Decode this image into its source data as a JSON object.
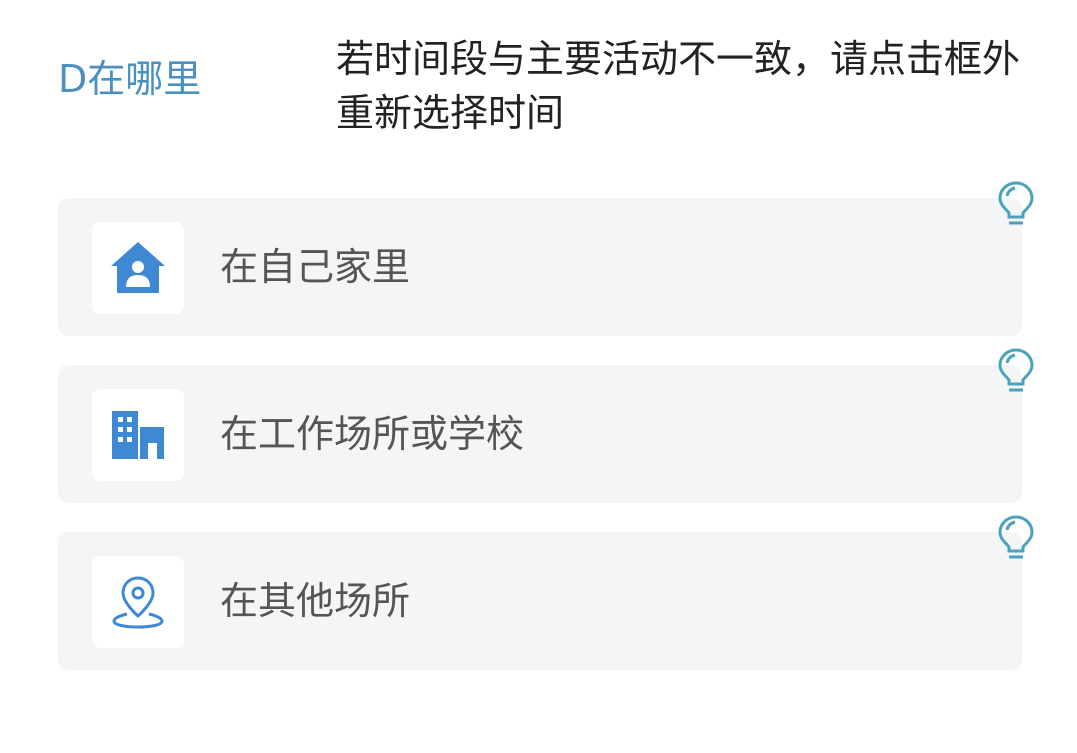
{
  "question": {
    "title": "D在哪里",
    "hint": "若时间段与主要活动不一致，请点击框外重新选择时间"
  },
  "options": [
    {
      "label": "在自己家里",
      "icon": "home-icon"
    },
    {
      "label": "在工作场所或学校",
      "icon": "building-icon"
    },
    {
      "label": "在其他场所",
      "icon": "location-pin-icon"
    }
  ],
  "hint_icon": "lightbulb-icon",
  "colors": {
    "accent": "#4a90c2",
    "icon_blue": "#3f89d4",
    "card_background": "#f4f5f7",
    "bulb_teal": "#4aa3b8",
    "label_gray": "#555555"
  }
}
